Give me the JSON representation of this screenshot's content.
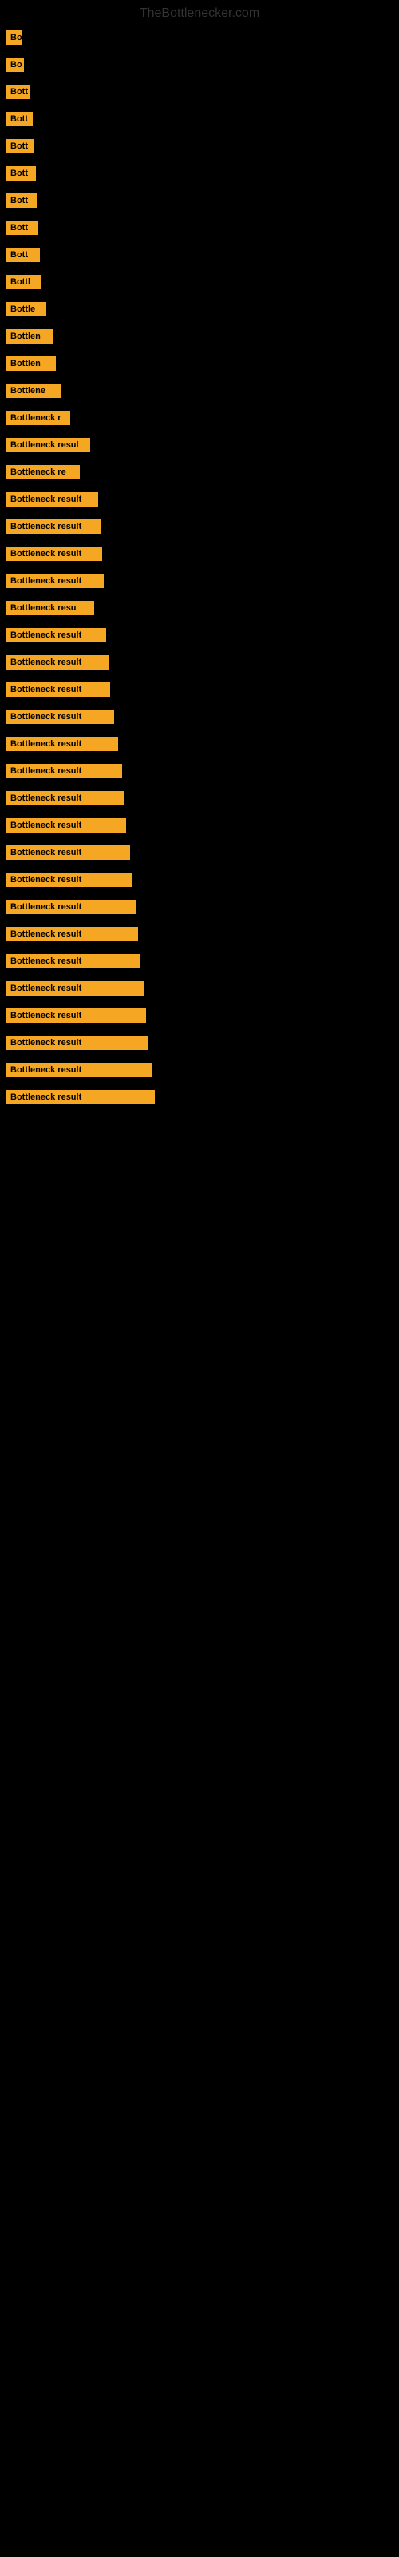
{
  "site": {
    "title": "TheBottlenecker.com"
  },
  "rows": [
    {
      "id": 1,
      "label": "Bo",
      "width": 20
    },
    {
      "id": 2,
      "label": "Bo",
      "width": 22
    },
    {
      "id": 3,
      "label": "Bott",
      "width": 30
    },
    {
      "id": 4,
      "label": "Bott",
      "width": 33
    },
    {
      "id": 5,
      "label": "Bott",
      "width": 35
    },
    {
      "id": 6,
      "label": "Bott",
      "width": 37
    },
    {
      "id": 7,
      "label": "Bott",
      "width": 38
    },
    {
      "id": 8,
      "label": "Bott",
      "width": 40
    },
    {
      "id": 9,
      "label": "Bott",
      "width": 42
    },
    {
      "id": 10,
      "label": "Bottl",
      "width": 44
    },
    {
      "id": 11,
      "label": "Bottle",
      "width": 50
    },
    {
      "id": 12,
      "label": "Bottlen",
      "width": 58
    },
    {
      "id": 13,
      "label": "Bottlen",
      "width": 62
    },
    {
      "id": 14,
      "label": "Bottlene",
      "width": 68
    },
    {
      "id": 15,
      "label": "Bottleneck r",
      "width": 80
    },
    {
      "id": 16,
      "label": "Bottleneck resul",
      "width": 105
    },
    {
      "id": 17,
      "label": "Bottleneck re",
      "width": 92
    },
    {
      "id": 18,
      "label": "Bottleneck result",
      "width": 115
    },
    {
      "id": 19,
      "label": "Bottleneck result",
      "width": 118
    },
    {
      "id": 20,
      "label": "Bottleneck result",
      "width": 120
    },
    {
      "id": 21,
      "label": "Bottleneck result",
      "width": 122
    },
    {
      "id": 22,
      "label": "Bottleneck resu",
      "width": 110
    },
    {
      "id": 23,
      "label": "Bottleneck result",
      "width": 125
    },
    {
      "id": 24,
      "label": "Bottleneck result",
      "width": 128
    },
    {
      "id": 25,
      "label": "Bottleneck result",
      "width": 130
    },
    {
      "id": 26,
      "label": "Bottleneck result",
      "width": 135
    },
    {
      "id": 27,
      "label": "Bottleneck result",
      "width": 140
    },
    {
      "id": 28,
      "label": "Bottleneck result",
      "width": 145
    },
    {
      "id": 29,
      "label": "Bottleneck result",
      "width": 148
    },
    {
      "id": 30,
      "label": "Bottleneck result",
      "width": 150
    },
    {
      "id": 31,
      "label": "Bottleneck result",
      "width": 155
    },
    {
      "id": 32,
      "label": "Bottleneck result",
      "width": 158
    },
    {
      "id": 33,
      "label": "Bottleneck result",
      "width": 162
    },
    {
      "id": 34,
      "label": "Bottleneck result",
      "width": 165
    },
    {
      "id": 35,
      "label": "Bottleneck result",
      "width": 168
    },
    {
      "id": 36,
      "label": "Bottleneck result",
      "width": 172
    },
    {
      "id": 37,
      "label": "Bottleneck result",
      "width": 175
    },
    {
      "id": 38,
      "label": "Bottleneck result",
      "width": 178
    },
    {
      "id": 39,
      "label": "Bottleneck result",
      "width": 182
    },
    {
      "id": 40,
      "label": "Bottleneck result",
      "width": 186
    }
  ]
}
